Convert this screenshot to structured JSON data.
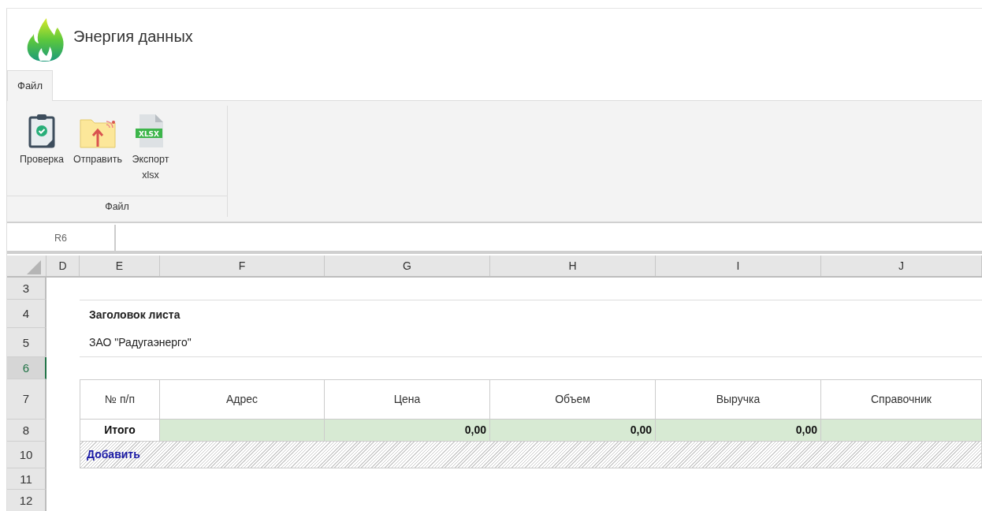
{
  "app": {
    "title": "Энергия данных"
  },
  "tabs": [
    {
      "label": "Файл",
      "selected": true
    }
  ],
  "ribbon": {
    "buttons": [
      {
        "label": "Проверка",
        "kind": "check"
      },
      {
        "label": "Отправить",
        "kind": "send"
      },
      {
        "label": "Экспорт xlsx",
        "kind": "xlsx",
        "icon_text": "XLSX"
      }
    ],
    "group_label": "Файл"
  },
  "name_box": {
    "value": "R6"
  },
  "sheet": {
    "columns": [
      "D",
      "E",
      "F",
      "G",
      "H",
      "I",
      "J"
    ],
    "rows": [
      {
        "label": "3",
        "selected": false,
        "kind": "blank"
      },
      {
        "label": "4",
        "selected": false,
        "kind": "title"
      },
      {
        "label": "5",
        "selected": false,
        "kind": "subtitle"
      },
      {
        "label": "6",
        "selected": true,
        "kind": "blank"
      },
      {
        "label": "7",
        "selected": false,
        "kind": "header"
      },
      {
        "label": "8",
        "selected": false,
        "kind": "total"
      },
      {
        "label": "10",
        "selected": false,
        "kind": "add"
      },
      {
        "label": "11",
        "selected": false,
        "kind": "blank"
      },
      {
        "label": "12",
        "selected": false,
        "kind": "blank"
      }
    ],
    "title": "Заголовок листа",
    "subtitle": "ЗАО \"Радугаэнерго\"",
    "table_headers": [
      "№ п/п",
      "Адрес",
      "Цена",
      "Объем",
      "Выручка",
      "Справочник"
    ],
    "total": {
      "label": "Итого",
      "cells": [
        {
          "kind": "empty"
        },
        {
          "kind": "number",
          "value": "0,00"
        },
        {
          "kind": "number",
          "value": "0,00"
        },
        {
          "kind": "number",
          "value": "0,00"
        },
        {
          "kind": "empty"
        }
      ]
    },
    "add_link": "Добавить"
  }
}
